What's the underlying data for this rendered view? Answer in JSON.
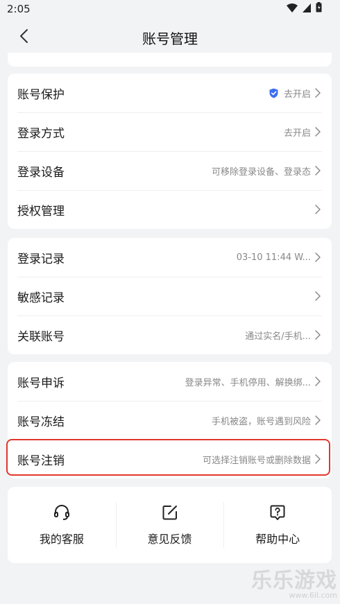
{
  "status": {
    "time": "2:05"
  },
  "header": {
    "title": "账号管理"
  },
  "group1": [
    {
      "label": "账号保护",
      "value": "去开启",
      "shield": true
    },
    {
      "label": "登录方式",
      "value": "去开启"
    },
    {
      "label": "登录设备",
      "value": "可移除登录设备、登录态"
    },
    {
      "label": "授权管理",
      "value": ""
    }
  ],
  "group2": [
    {
      "label": "登录记录",
      "value": "03-10 11:44 W..."
    },
    {
      "label": "敏感记录",
      "value": ""
    },
    {
      "label": "关联账号",
      "value": "通过实名/手机..."
    }
  ],
  "group3": [
    {
      "label": "账号申诉",
      "value": "登录异常、手机停用、解换绑..."
    },
    {
      "label": "账号冻结",
      "value": "手机被盗，账号遇到风险"
    },
    {
      "label": "账号注销",
      "value": "可选择注销账号或删除数据"
    }
  ],
  "actions": [
    {
      "label": "我的客服",
      "icon": "headset-icon"
    },
    {
      "label": "意见反馈",
      "icon": "edit-icon"
    },
    {
      "label": "帮助中心",
      "icon": "help-icon"
    }
  ],
  "watermark": {
    "main": "乐乐游戏",
    "sub": "www.6ll.com"
  },
  "colors": {
    "highlight": "#e0362c",
    "shield": "#3d6ef5",
    "background": "#f2f3f5"
  }
}
